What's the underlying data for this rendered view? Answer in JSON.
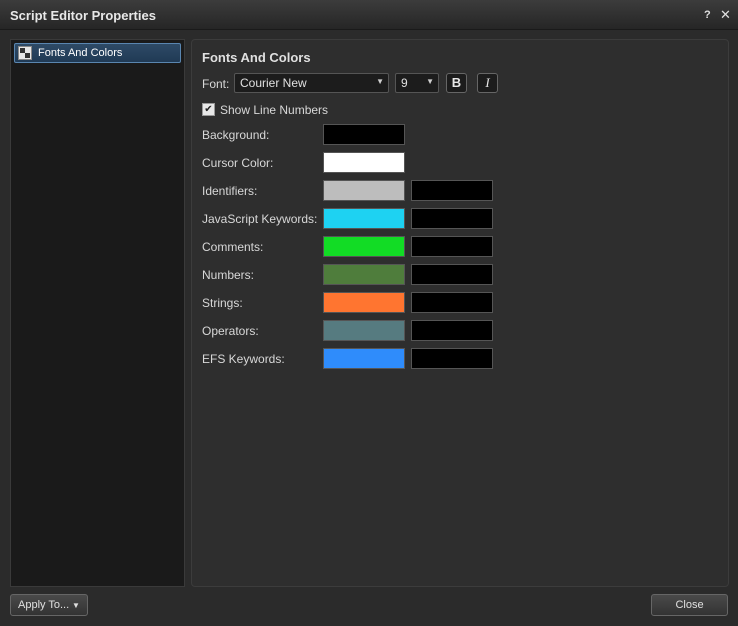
{
  "window": {
    "title": "Script Editor Properties",
    "help_label": "?",
    "close_label": "✕"
  },
  "sidebar": {
    "items": [
      {
        "label": "Fonts And Colors"
      }
    ]
  },
  "panel": {
    "title": "Fonts And Colors",
    "font_label": "Font:",
    "font_value": "Courier New",
    "size_value": "9",
    "bold_label": "B",
    "italic_label": "I",
    "show_line_numbers_label": "Show Line Numbers",
    "show_line_numbers_checked": true,
    "rows": [
      {
        "label": "Background:",
        "fg": "#000000"
      },
      {
        "label": "Cursor Color:",
        "fg": "#ffffff"
      },
      {
        "label": "Identifiers:",
        "fg": "#bdbdbd",
        "bg": "#000000"
      },
      {
        "label": "JavaScript Keywords:",
        "fg": "#1ed2f2",
        "bg": "#000000"
      },
      {
        "label": "Comments:",
        "fg": "#12dc25",
        "bg": "#000000"
      },
      {
        "label": "Numbers:",
        "fg": "#4f7d3c",
        "bg": "#000000"
      },
      {
        "label": "Strings:",
        "fg": "#ff7530",
        "bg": "#000000"
      },
      {
        "label": "Operators:",
        "fg": "#567b80",
        "bg": "#000000"
      },
      {
        "label": "EFS Keywords:",
        "fg": "#2f8cfb",
        "bg": "#000000"
      }
    ]
  },
  "footer": {
    "apply_label": "Apply To...",
    "close_label": "Close"
  }
}
